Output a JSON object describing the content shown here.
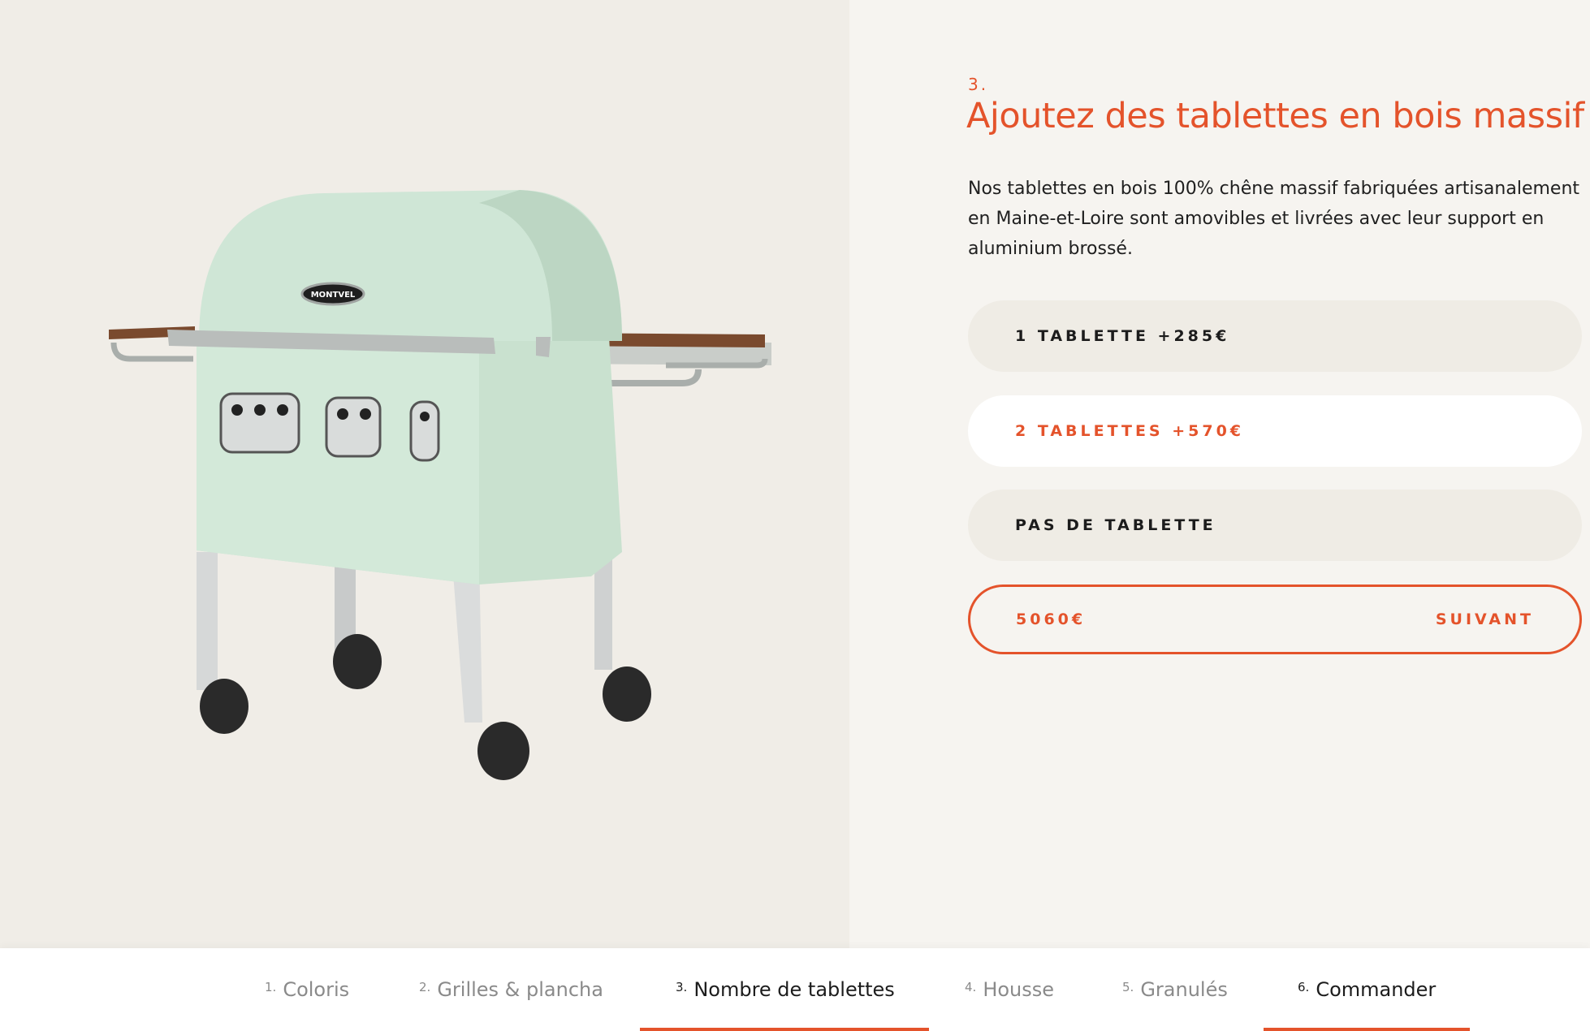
{
  "colors": {
    "accent": "#e4532b",
    "panel_left": "#f0ede7",
    "panel_right": "#f6f4f0",
    "option_bg": "#efece5",
    "grill_body": "#cfe6d6"
  },
  "product": {
    "brand_plate": "MONTVEL"
  },
  "step": {
    "number": "3.",
    "title": "Ajoutez des tablettes en bois massif",
    "description": "Nos tablettes en bois 100% chêne massif fabriquées artisanalement en Maine-et-Loire sont amovibles et livrées avec leur support en aluminium brossé."
  },
  "options": [
    {
      "label": "1 TABLETTE +285€",
      "selected": false
    },
    {
      "label": "2 TABLETTES +570€",
      "selected": true
    },
    {
      "label": "PAS DE TABLETTE",
      "selected": false
    }
  ],
  "footer_action": {
    "price": "5060€",
    "next_label": "SUIVANT"
  },
  "nav": [
    {
      "num": "1.",
      "label": "Coloris",
      "active": false
    },
    {
      "num": "2.",
      "label": "Grilles & plancha",
      "active": false
    },
    {
      "num": "3.",
      "label": "Nombre de tablettes",
      "active": true
    },
    {
      "num": "4.",
      "label": "Housse",
      "active": false
    },
    {
      "num": "5.",
      "label": "Granulés",
      "active": false
    },
    {
      "num": "6.",
      "label": "Commander",
      "active": false
    }
  ]
}
